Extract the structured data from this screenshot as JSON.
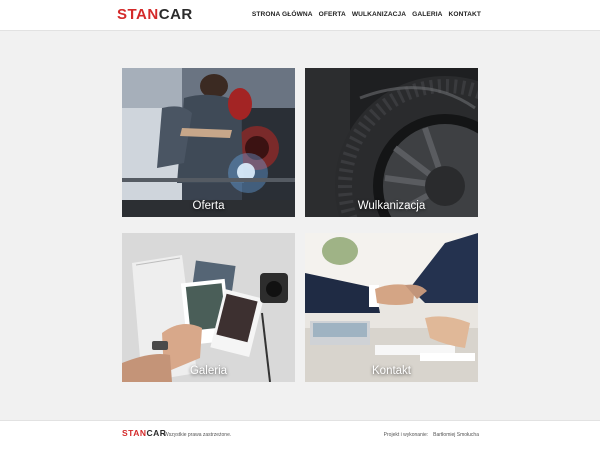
{
  "brand": {
    "part1": "STAN",
    "part2": "CAR",
    "accent": "#d42a2a",
    "dark": "#2b2b2b"
  },
  "nav": {
    "items": [
      "STRONA GŁÓWNA",
      "OFERTA",
      "WULKANIZACJA",
      "GALERIA",
      "KONTAKT"
    ]
  },
  "tiles": [
    {
      "label": "Oferta",
      "image": "welder-photo"
    },
    {
      "label": "Wulkanizacja",
      "image": "tire-photo"
    },
    {
      "label": "Galeria",
      "image": "photos-in-hand"
    },
    {
      "label": "Kontakt",
      "image": "handshake-photo"
    }
  ],
  "footer": {
    "rights": "Wszystkie prawa zastrzeżone.",
    "credit_label": "Projekt i wykonanie:",
    "credit_name": "Bartłomiej Smołucha"
  }
}
